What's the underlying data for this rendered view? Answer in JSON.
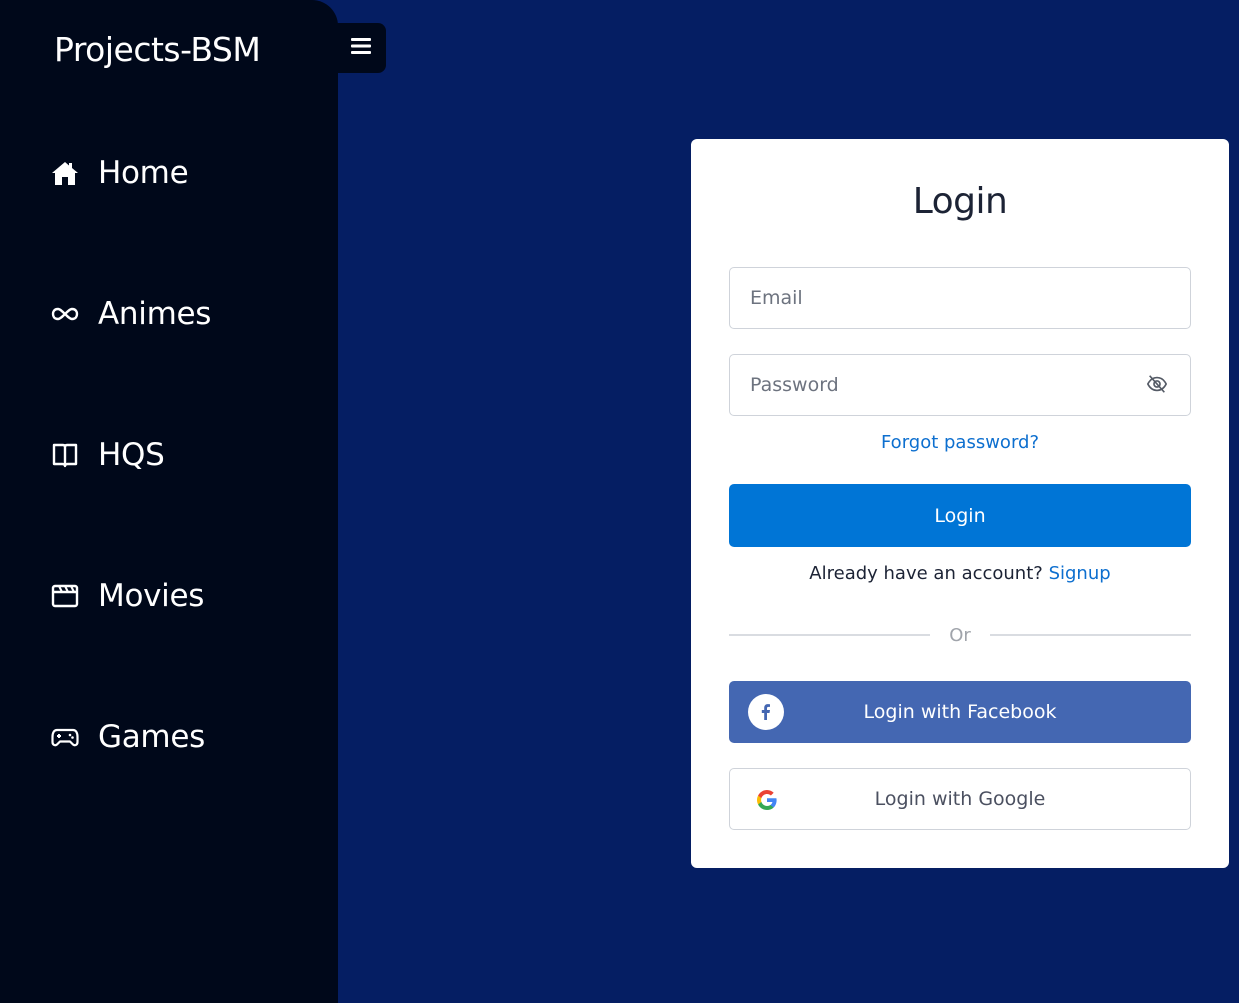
{
  "sidebar": {
    "brand": "Projects-BSM",
    "items": [
      {
        "label": "Home",
        "icon": "home-icon"
      },
      {
        "label": "Animes",
        "icon": "infinity-icon"
      },
      {
        "label": "HQS",
        "icon": "book-icon"
      },
      {
        "label": "Movies",
        "icon": "clapperboard-icon"
      },
      {
        "label": "Games",
        "icon": "gamepad-icon"
      }
    ]
  },
  "header": {
    "menu_icon": "menu-icon"
  },
  "login": {
    "title": "Login",
    "email_placeholder": "Email",
    "password_placeholder": "Password",
    "forgot_label": "Forgot password?",
    "submit_label": "Login",
    "signup_prompt": "Already have an account?",
    "signup_link": "Signup",
    "divider_label": "Or",
    "facebook_label": "Login with Facebook",
    "google_label": "Login with Google"
  },
  "colors": {
    "background": "#051e63",
    "sidebar": "#00081a",
    "primary": "#0075d6",
    "facebook": "#4467b2",
    "link": "#0d6fcf"
  }
}
